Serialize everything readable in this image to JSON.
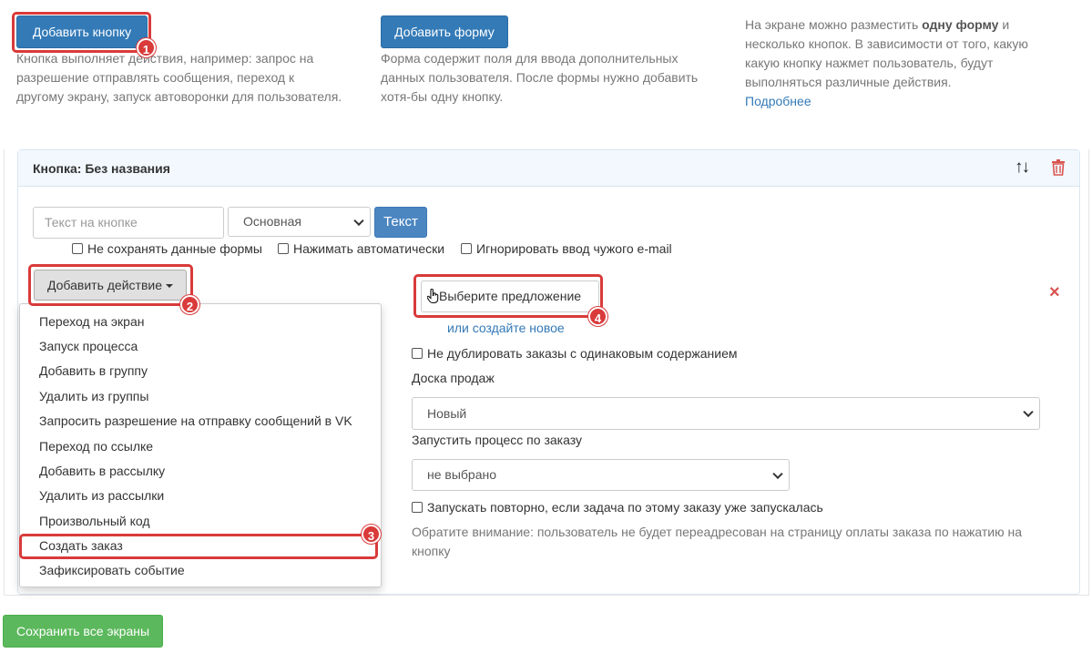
{
  "top": {
    "add_button_label": "Добавить кнопку",
    "add_button_desc": "Кнопка выполняет действия, например: запрос на разрешение отправлять сообщения, переход к другому экрану, запуск автоворонки для пользователя.",
    "add_form_label": "Добавить форму",
    "add_form_desc": "Форма содержит поля для ввода дополнительных данных пользователя. После формы нужно добавить хотя-бы одну кнопку.",
    "info_pre": "На экране можно разместить ",
    "info_bold": "одну форму",
    "info_post": " и несколько кнопок. В зависимости от того, какую какую кнопку нажмет пользователь, будут выполняться различные действия.",
    "more_link": "Подробнее"
  },
  "panel": {
    "title": "Кнопка: Без названия",
    "move_icon": "↑↓",
    "delete_icon": "trash-icon"
  },
  "button_settings": {
    "text_placeholder": "Текст на кнопке",
    "style_selected": "Основная",
    "text_button": "Текст",
    "chk_no_save": "Не сохранять данные формы",
    "chk_auto_press": "Нажимать автоматически",
    "chk_ignore_email": "Игнорировать ввод чужого e-mail"
  },
  "actions": {
    "add_action_label": "Добавить действие",
    "menu": [
      "Переход на экран",
      "Запуск процесса",
      "Добавить в группу",
      "Удалить из группы",
      "Запросить разрешение на отправку сообщений в VK",
      "Переход по ссылке",
      "Добавить в рассылку",
      "Удалить из рассылки",
      "Произвольный код",
      "Создать заказ",
      "Зафиксировать событие"
    ]
  },
  "order": {
    "choose_offer": "Выберите предложение",
    "or_create": "или создайте новое",
    "chk_no_duplicate": "Не дублировать заказы с одинаковым содержанием",
    "sales_board_label": "Доска продаж",
    "sales_board_value": "Новый",
    "run_process_label": "Запустить процесс по заказу",
    "run_process_value": "не выбрано",
    "chk_rerun": "Запускать повторно, если задача по этому заказу уже запускалась",
    "note": "Обратите внимание: пользователь не будет переадресован на страницу оплаты заказа по нажатию на кнопку",
    "remove_icon": "×"
  },
  "callouts": [
    "1",
    "2",
    "3",
    "4"
  ],
  "save_all_label": "Сохранить все экраны",
  "colors": {
    "primary": "#337ab7",
    "success": "#5cb85c",
    "callout": "#d93a3a",
    "danger": "#d9534f"
  }
}
